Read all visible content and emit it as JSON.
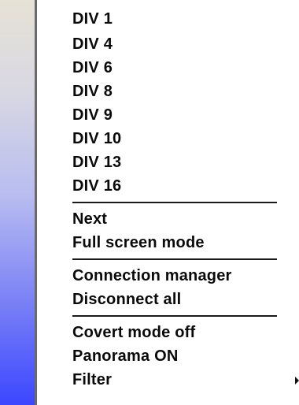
{
  "menu": {
    "div_items": [
      {
        "label": "DIV 1"
      },
      {
        "label": "DIV 4"
      },
      {
        "label": "DIV 6"
      },
      {
        "label": "DIV 8"
      },
      {
        "label": "DIV 9"
      },
      {
        "label": "DIV 10"
      },
      {
        "label": "DIV 13"
      },
      {
        "label": "DIV 16"
      }
    ],
    "view_items": [
      {
        "label": "Next"
      },
      {
        "label": "Full screen mode"
      }
    ],
    "connection_items": [
      {
        "label": "Connection manager"
      },
      {
        "label": "Disconnect all"
      }
    ],
    "mode_items": [
      {
        "label": "Covert mode off"
      },
      {
        "label": "Panorama ON"
      },
      {
        "label": "Filter",
        "has_submenu": true,
        "submenu_icon": "chevron-right-icon"
      }
    ]
  }
}
